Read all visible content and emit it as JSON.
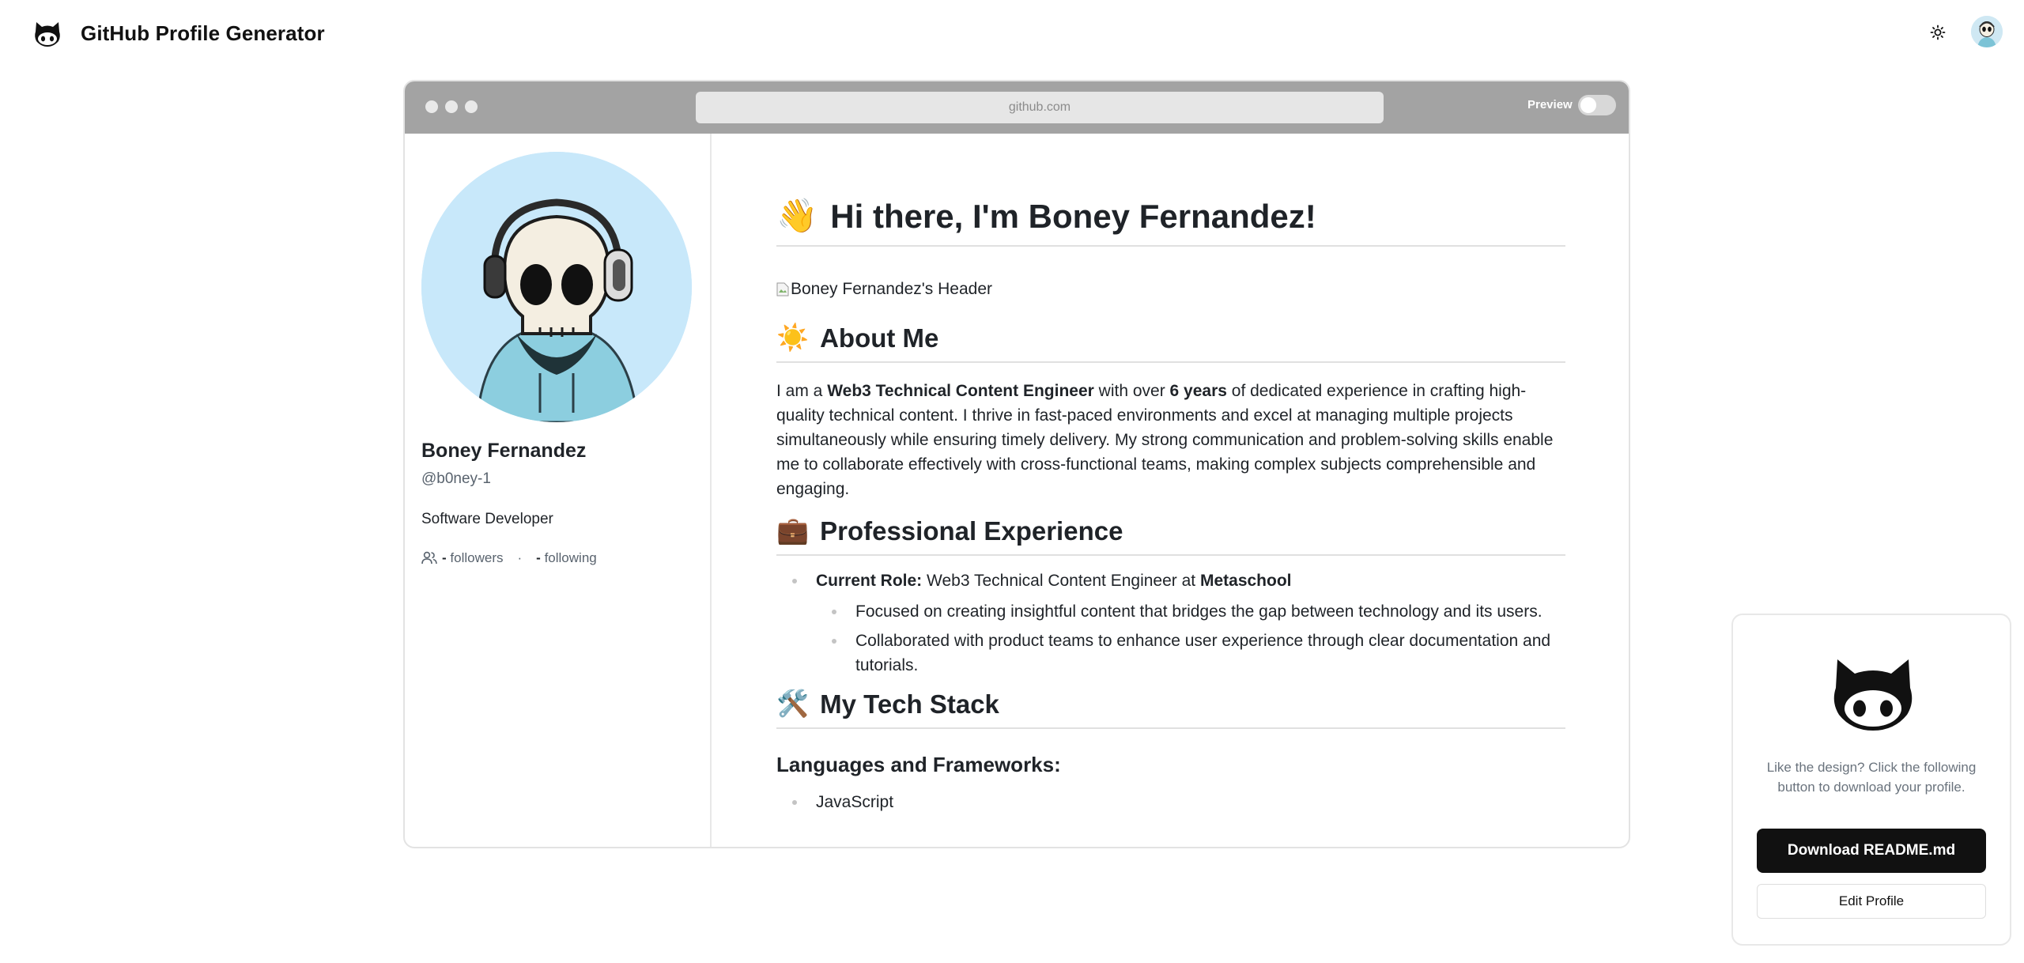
{
  "app": {
    "title": "GitHub Profile Generator",
    "icons": {
      "brand": "octocat-icon",
      "theme": "sun-icon",
      "user": "avatar"
    }
  },
  "browser": {
    "url": "github.com",
    "preview_label": "Preview",
    "preview_on": false
  },
  "profile": {
    "name": "Boney Fernandez",
    "handle": "@b0ney-1",
    "bio": "Software Developer",
    "followers_count": "-",
    "followers_label": "followers",
    "separator": "·",
    "following_count": "-",
    "following_label": "following"
  },
  "readme": {
    "greeting_emoji": "👋",
    "greeting": "Hi there, I'm Boney Fernandez!",
    "header_image_alt": "Boney Fernandez's Header",
    "about": {
      "emoji": "☀️",
      "title": "About Me",
      "p1": "I am a ",
      "b1": "Web3 Technical Content Engineer",
      "p2": " with over ",
      "b2": "6 years",
      "p3": " of dedicated experience in crafting high-quality technical content. I thrive in fast-paced environments and excel at managing multiple projects simultaneously while ensuring timely delivery. My strong communication and problem-solving skills enable me to collaborate effectively with cross-functional teams, making complex subjects comprehensible and engaging."
    },
    "experience": {
      "emoji": "💼",
      "title": "Professional Experience",
      "role_label": "Current Role:",
      "role_text": " Web3 Technical Content Engineer at ",
      "company": "Metaschool",
      "bullets": [
        "Focused on creating insightful content that bridges the gap between technology and its users.",
        "Collaborated with product teams to enhance user experience through clear documentation and tutorials."
      ]
    },
    "tech": {
      "emoji": "🛠️",
      "title": "My Tech Stack",
      "subtitle": "Languages and Frameworks:",
      "items": [
        "JavaScript"
      ]
    }
  },
  "download_card": {
    "text": "Like the design? Click the following button to download your profile.",
    "download_label": "Download README.md",
    "edit_label": "Edit Profile"
  }
}
